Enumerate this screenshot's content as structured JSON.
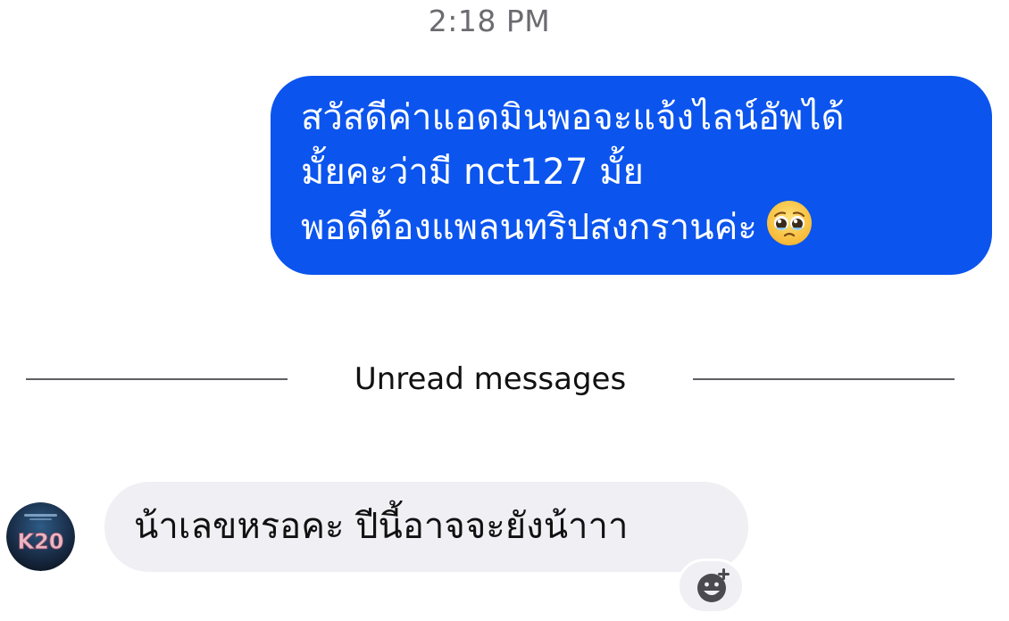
{
  "thread": {
    "timestamp": "2:18 PM",
    "outgoing_message": {
      "lines": [
        "สวัสดีค่าแอดมินพอจะแจ้งไลน์อัพได้",
        "มั้ยคะว่ามี nct127 มั้ย",
        "พอดีต้องแพลนทริปสงกรานค่ะ"
      ],
      "emoji": "pleading-face-with-tears-emoji"
    },
    "unread_divider_label": "Unread messages",
    "incoming_message": {
      "text": "น้าเลขหรอคะ ปีนี้อาจจะยังน้าาา",
      "avatar_text": "K20"
    },
    "reaction_icon": "add-reaction-smiley-icon"
  },
  "colors": {
    "outgoing_bubble": "#0b54ee",
    "incoming_bubble": "#efeff4",
    "timestamp_text": "#6b6b70",
    "divider": "#5f5f64"
  }
}
